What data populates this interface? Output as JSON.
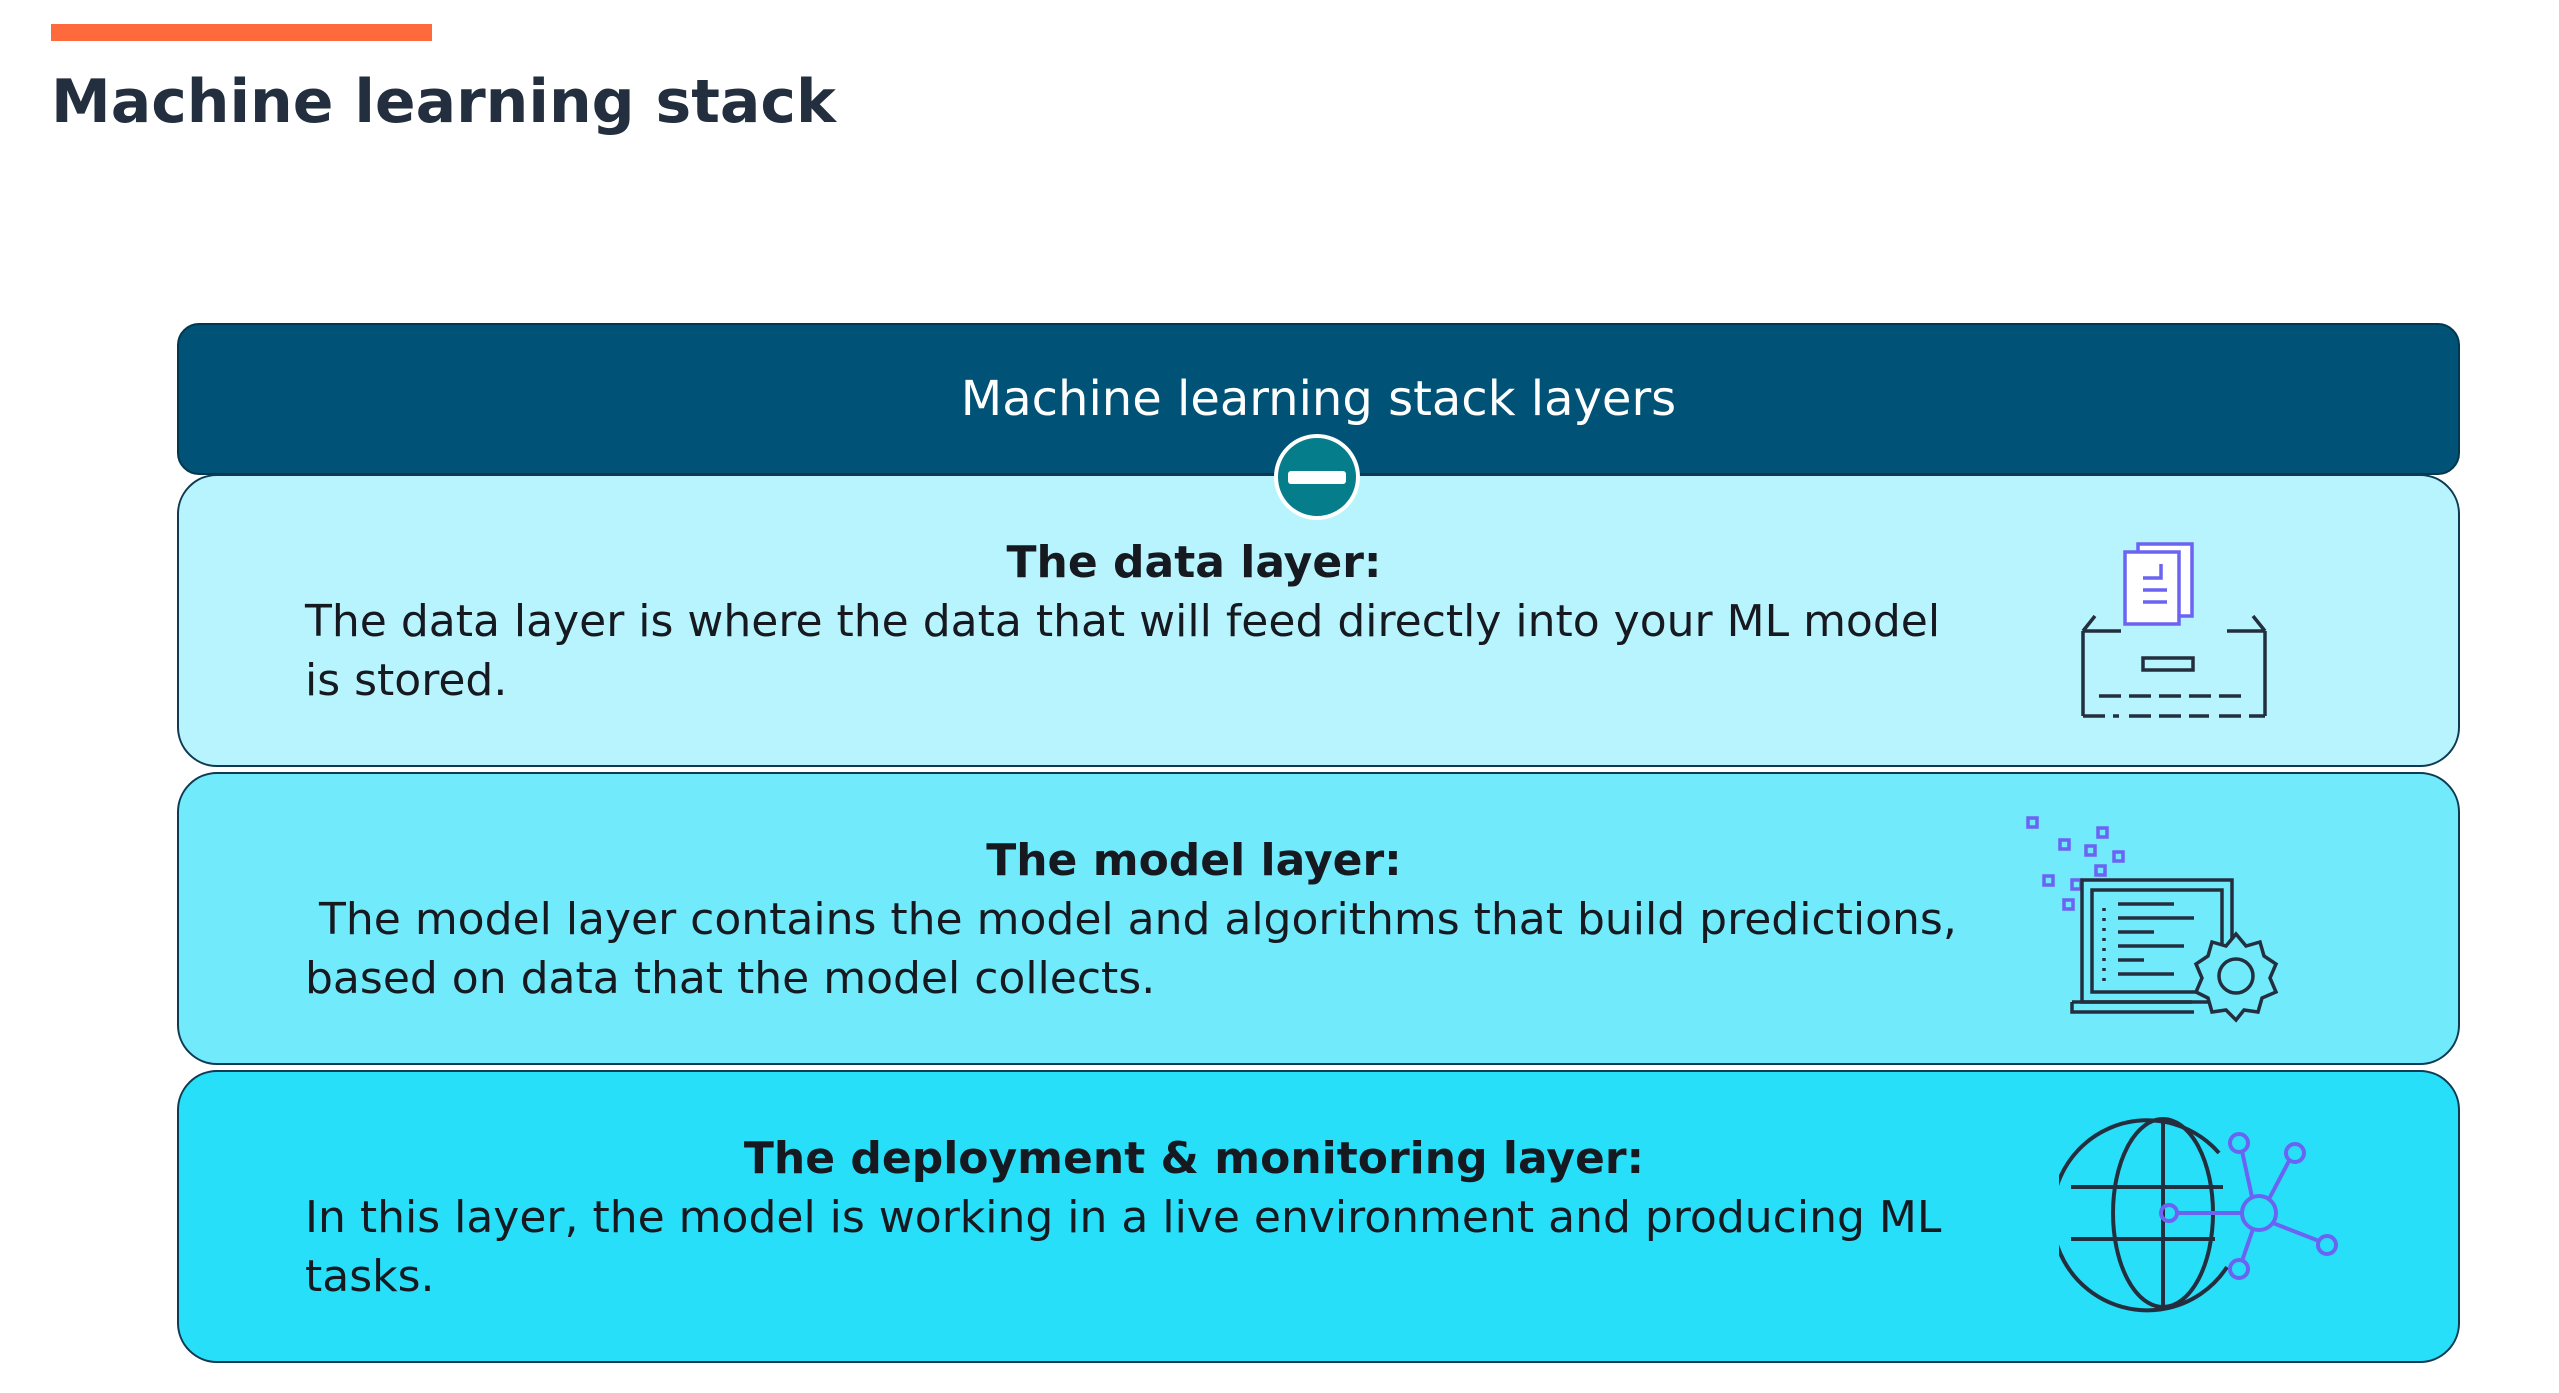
{
  "page": {
    "title": "Machine learning stack"
  },
  "stack": {
    "header": "Machine learning stack layers",
    "toggle_icon": "minus-icon",
    "layers": [
      {
        "heading": "The data layer:",
        "body": "The data layer is where the data that will feed directly into your ML model\nis stored.",
        "icon": "data-storage-icon"
      },
      {
        "heading": "The model layer:",
        "body": " The model layer contains the model and algorithms that build predictions,\nbased on data that the model collects.",
        "icon": "model-computer-gear-icon"
      },
      {
        "heading": "The deployment & monitoring layer:",
        "body": "In this layer, the model is working in a live environment and producing ML\ntasks.",
        "icon": "globe-network-icon"
      }
    ]
  },
  "colors": {
    "accent": "#ff6a3d",
    "header_bg": "#005276",
    "layer_1_bg": "#b8f4fd",
    "layer_2_bg": "#71eafc",
    "layer_3_bg": "#28dffa",
    "toggle_bg": "#067d8b"
  }
}
